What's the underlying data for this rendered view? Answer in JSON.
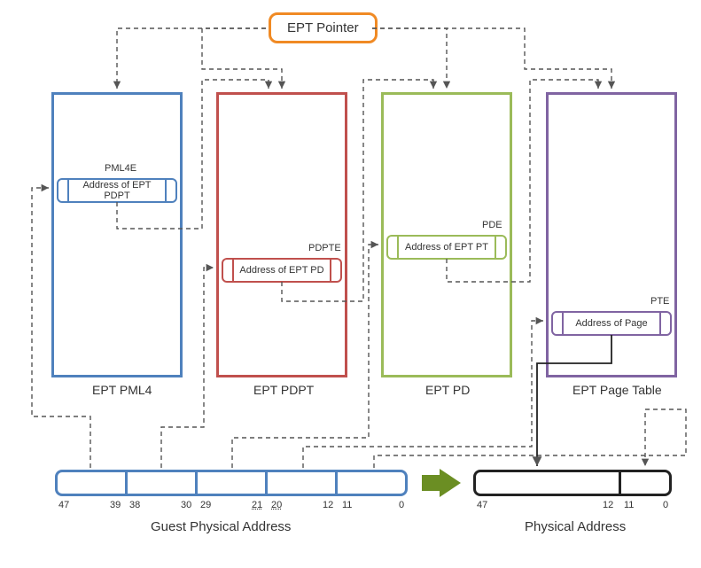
{
  "header": {
    "pointer_label": "EPT Pointer"
  },
  "tables": {
    "pml4": {
      "caption": "EPT PML4",
      "entry_tag": "PML4E",
      "entry_text": "Address of EPT PDPT"
    },
    "pdpt": {
      "caption": "EPT PDPT",
      "entry_tag": "PDPTE",
      "entry_text": "Address of EPT PD"
    },
    "pd": {
      "caption": "EPT PD",
      "entry_tag": "PDE",
      "entry_text": "Address of EPT PT"
    },
    "pt": {
      "caption": "EPT Page Table",
      "entry_tag": "PTE",
      "entry_text": "Address of Page"
    }
  },
  "gpa": {
    "caption": "Guest Physical Address",
    "bits": [
      "47",
      "39",
      "38",
      "30",
      "29",
      "21",
      "20",
      "12",
      "11",
      "0"
    ]
  },
  "pa": {
    "caption": "Physical Address",
    "bits": [
      "47",
      "12",
      "11",
      "0"
    ]
  },
  "colors": {
    "orange": "#f08a24",
    "blue": "#4f81bd",
    "red": "#c0504d",
    "green": "#9bbb59",
    "purple": "#8064a2",
    "black": "#222222",
    "olive": "#6b8e23"
  }
}
